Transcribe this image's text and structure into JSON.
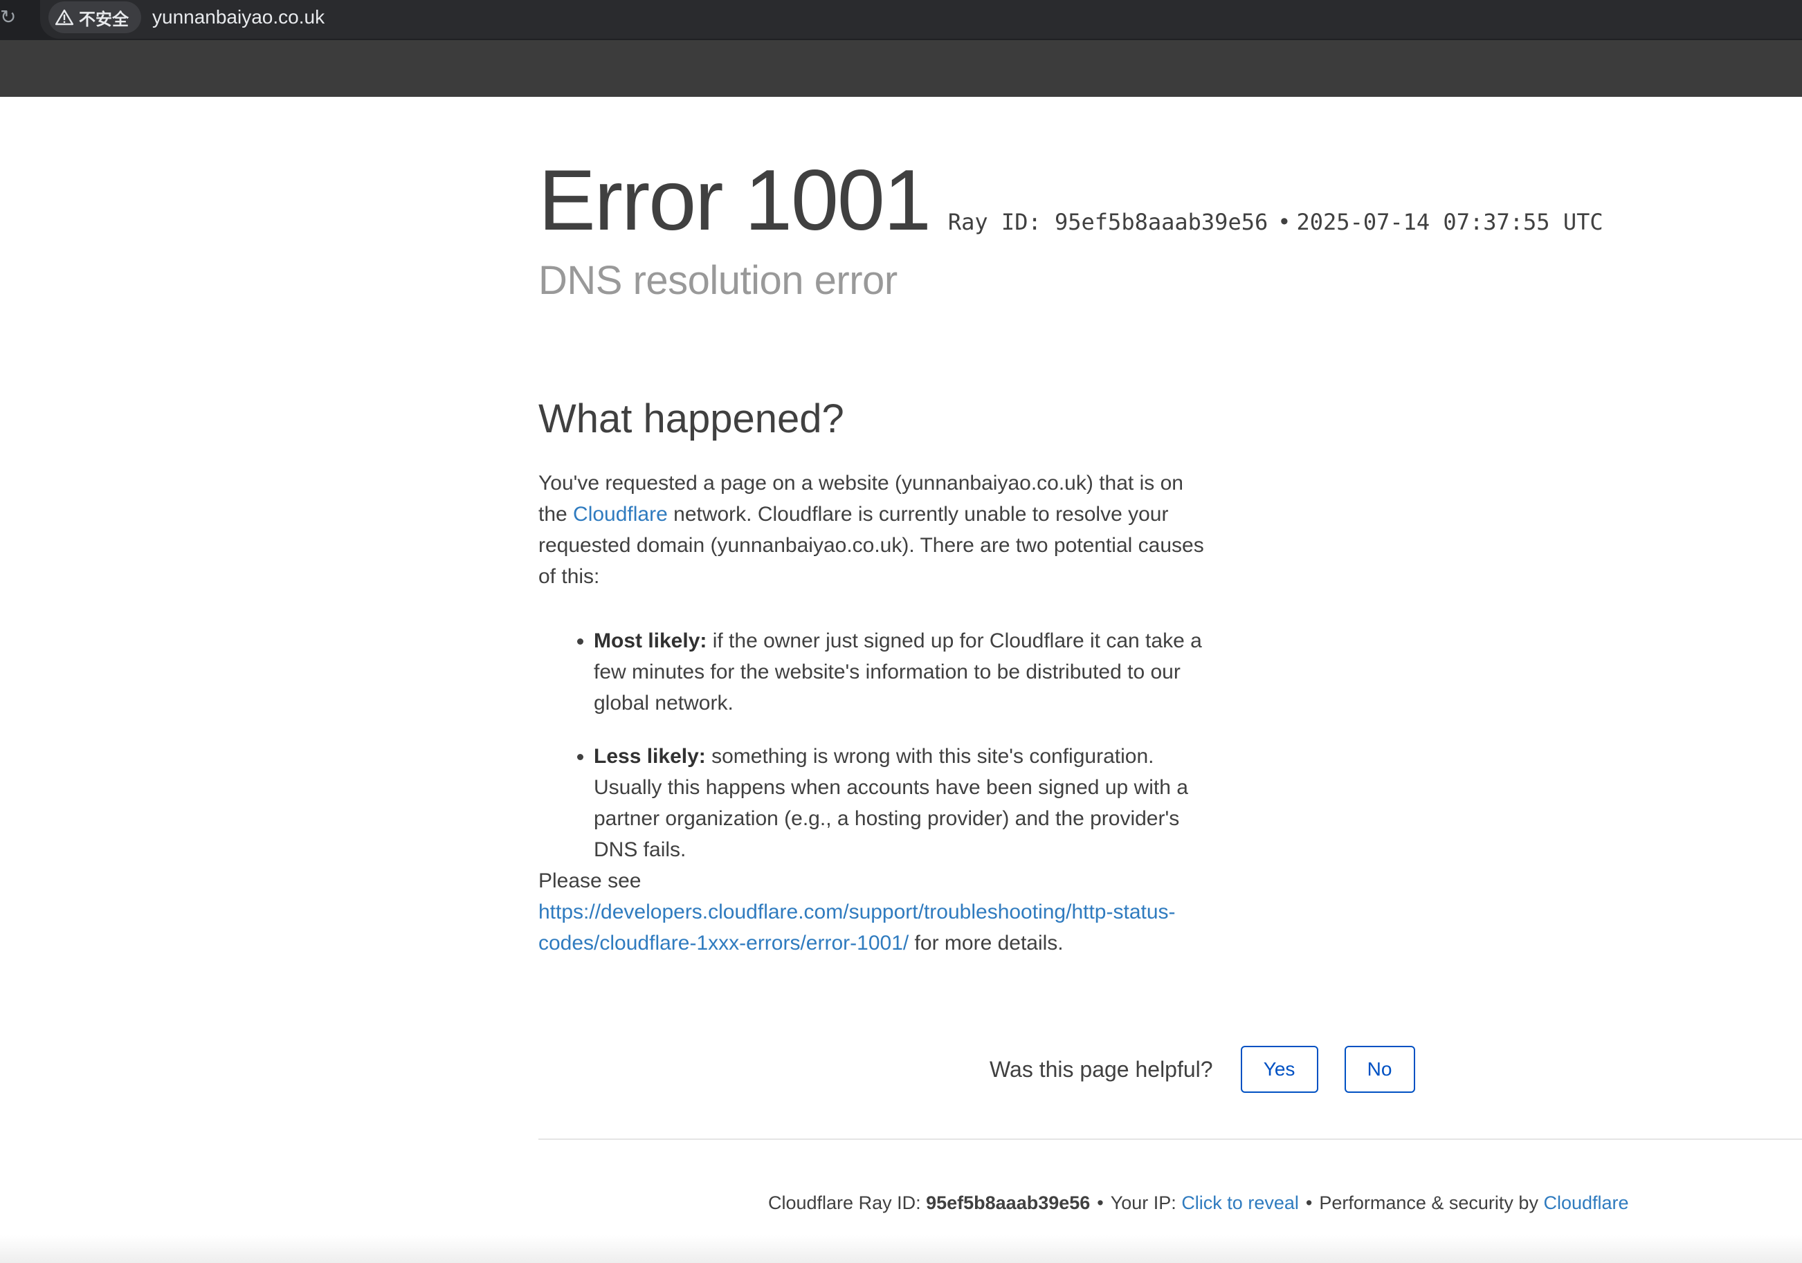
{
  "browser": {
    "security_label": "不安全",
    "url": "yunnanbaiyao.co.uk",
    "icons": {
      "reload": "reload-icon",
      "warning": "warning-icon"
    }
  },
  "error": {
    "title": "Error 1001",
    "ray_label": "Ray ID: 95ef5b8aaab39e56",
    "separator": "•",
    "timestamp": "2025-07-14 07:37:55 UTC",
    "subtitle": "DNS resolution error"
  },
  "what_happened": {
    "heading": "What happened?",
    "p1_before": "You've requested a page on a website (yunnanbaiyao.co.uk) that is on the ",
    "p1_link": "Cloudflare",
    "p1_after": " network. Cloudflare is currently unable to resolve your requested domain (yunnanbaiyao.co.uk). There are two potential causes of this:",
    "causes": [
      {
        "label": "Most likely:",
        "text": " if the owner just signed up for Cloudflare it can take a few minutes for the website's information to be distributed to our global network."
      },
      {
        "label": "Less likely:",
        "text": " something is wrong with this site's configuration. Usually this happens when accounts have been signed up with a partner organization (e.g., a hosting provider) and the provider's DNS fails."
      }
    ],
    "see_prefix": "Please see",
    "see_link": "https://developers.cloudflare.com/support/troubleshooting/http-status-codes/cloudflare-1xxx-errors/error-1001/",
    "see_suffix": " for more details."
  },
  "feedback": {
    "question": "Was this page helpful?",
    "yes": "Yes",
    "no": "No"
  },
  "footer": {
    "ray_prefix": "Cloudflare Ray ID: ",
    "ray_id": "95ef5b8aaab39e56",
    "sep1": "•",
    "ip_prefix": "Your IP: ",
    "ip_link": "Click to reveal",
    "sep2": "•",
    "perf_prefix": "Performance & security by ",
    "perf_link": "Cloudflare"
  },
  "colors": {
    "link": "#2f7bbf",
    "button": "#0051c3",
    "subtitle": "#999999",
    "text": "#404040"
  }
}
